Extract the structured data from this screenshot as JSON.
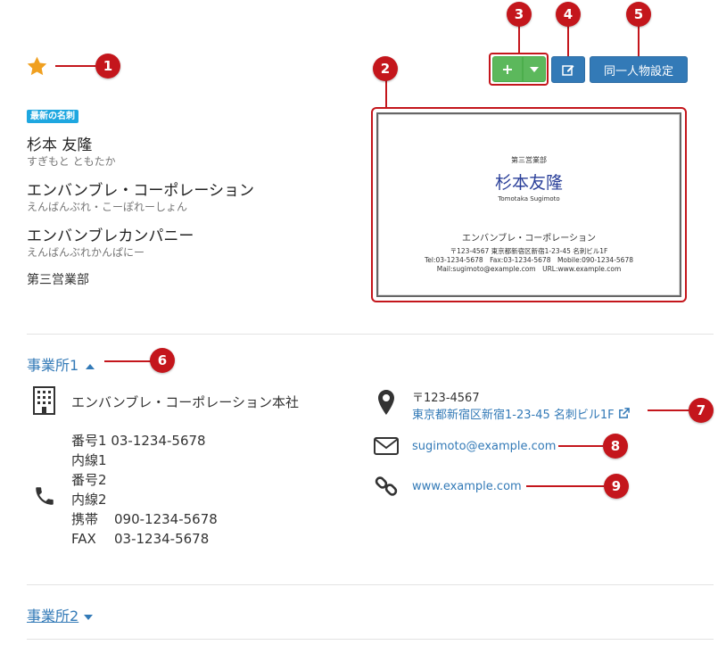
{
  "callouts": [
    "1",
    "2",
    "3",
    "4",
    "5",
    "6",
    "7",
    "8",
    "9"
  ],
  "badge": "最新の名刺",
  "person": {
    "name": "杉本 友隆",
    "name_kana": "すぎもと ともたか",
    "company": "エンバンブレ・コーポレーション",
    "company_kana": "えんばんぶれ・こーぽれーしょん",
    "company2": "エンバンブレカンパニー",
    "company2_kana": "えんばんぶれかんぱにー",
    "department": "第三営業部"
  },
  "card": {
    "department": "第三営業部",
    "name": "杉本友隆",
    "name_roman": "Tomotaka Sugimoto",
    "company": "エンバンブレ・コーポレーション",
    "address": "〒123-4567 東京都新宿区新宿1-23-45 名刺ビル1F",
    "phones": "Tel:03-1234-5678　Fax:03-1234-5678　Mobile:090-1234-5678",
    "mail_url": "Mail:sugimoto@example.com　URL:www.example.com"
  },
  "toolbar": {
    "add_icon": "+",
    "dropdown_icon": "caret-down",
    "edit_icon": "edit-icon",
    "same_person_label": "同一人物設定"
  },
  "office1": {
    "title": "事業所1",
    "name": "エンバンブレ・コーポレーション本社",
    "phones": [
      {
        "label": "番号1",
        "value": "03-1234-5678"
      },
      {
        "label": "内線1",
        "value": ""
      },
      {
        "label": "番号2",
        "value": ""
      },
      {
        "label": "内線2",
        "value": ""
      },
      {
        "label": "携帯",
        "value": "090-1234-5678"
      },
      {
        "label": "FAX",
        "value": "03-1234-5678"
      }
    ],
    "postal": "〒123-4567",
    "address": "東京都新宿区新宿1-23-45 名刺ビル1F",
    "email": "sugimoto@example.com",
    "url": "www.example.com"
  },
  "office2": {
    "title": "事業所2"
  },
  "colors": {
    "callout": "#c4161c",
    "link": "#337ab7",
    "green": "#5cb85c",
    "star": "#f0a020",
    "badge": "#1ea7e0"
  }
}
